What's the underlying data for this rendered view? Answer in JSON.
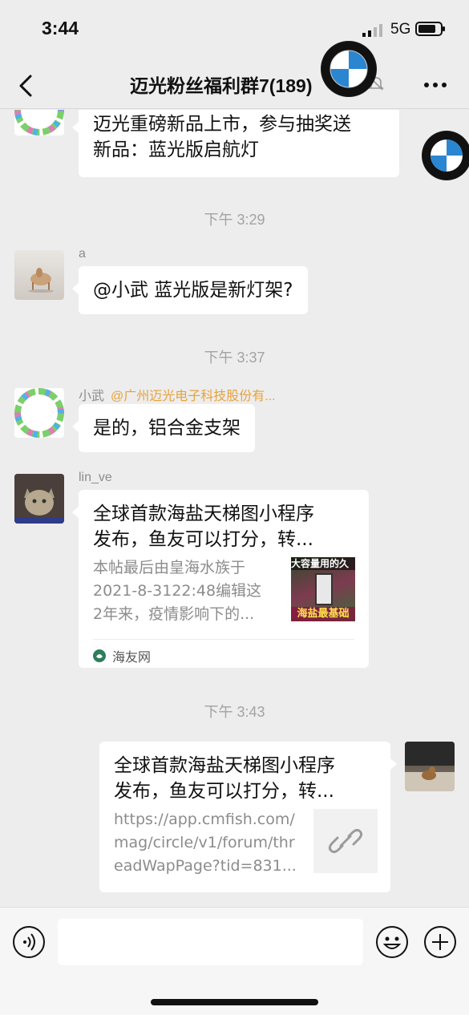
{
  "status_bar": {
    "time": "3:44",
    "network": "5G"
  },
  "nav": {
    "title": "迈光粉丝福利群7(189)"
  },
  "messages": {
    "m1": {
      "text_line1": "迈光重磅新品上市，参与抽奖送",
      "text_line2": "新品：蓝光版启航灯"
    },
    "t1": "下午 3:29",
    "m2": {
      "sender": "a",
      "text": "@小武 蓝光版是新灯架?"
    },
    "t2": "下午 3:37",
    "m3": {
      "sender": "小武",
      "mention": "@广州迈光电子科技股份有...",
      "text": "是的，铝合金支架"
    },
    "m4": {
      "sender": "lin_ve",
      "title_line1": "全球首款海盐天梯图小程序",
      "title_line2": "发布，鱼友可以打分，转...",
      "desc_line1": "本帖最后由皇海水族于",
      "desc_line2": "2021-8-3122:48编辑这",
      "desc_line3": "2年来，疫情影响下的...",
      "thumb_top_text": "大容量用的久",
      "thumb_bottom_text": "海盐最基础",
      "source": "海友网"
    },
    "t3": "下午 3:43",
    "m5": {
      "title_line1": "全球首款海盐天梯图小程序",
      "title_line2": "发布，鱼友可以打分，转...",
      "url_line1": "https://app.cmfish.com/",
      "url_line2": "mag/circle/v1/forum/thr",
      "url_line3": "eadWapPage?tid=831..."
    }
  },
  "colors": {
    "background": "#ededed",
    "mention": "#e6a23c",
    "meta_text": "#8c8c8c"
  },
  "icons": [
    "back-icon",
    "mute-icon",
    "more-icon",
    "voice-icon",
    "emoji-icon",
    "plus-icon",
    "link-icon",
    "bmw-logo"
  ]
}
